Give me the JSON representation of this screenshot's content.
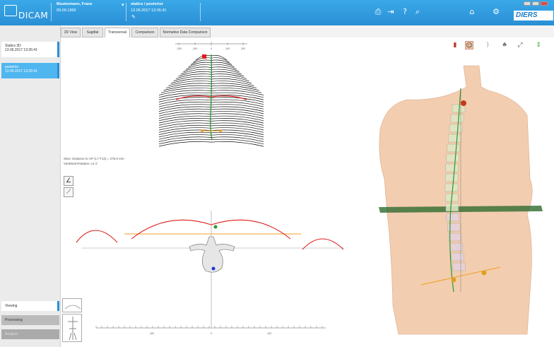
{
  "header": {
    "logo_text": "DICAM",
    "patient_name": "Mustermann, Franz",
    "patient_dob": "09.09.1966",
    "study_title": "statics / posterior",
    "study_date": "13.06.2017 13:26:41",
    "brand": "DIERS"
  },
  "studies": [
    {
      "label": "Statics 3D",
      "date": "13.06.2017 13:26:41"
    },
    {
      "label": "posterior",
      "date": "13.06.2017 13:26:41"
    }
  ],
  "nav": {
    "viewing": "Viewing",
    "processing": "Processing",
    "analysis": "Analysis"
  },
  "tabs": [
    "3D View",
    "Sagittal",
    "Transversal",
    "Comparison",
    "Normative Data Comparison"
  ],
  "active_tab": "Transversal",
  "info": {
    "slice_line": "Slice: Distance to VP (L7-T12) = 276.0 mm",
    "rotation_line": "Vertebral Rotation: L3 1°"
  },
  "scale": {
    "top_ticks": [
      "-200",
      "-100",
      "0",
      "100",
      "200"
    ],
    "bottom_ticks": [
      "-100",
      "0",
      "100"
    ]
  },
  "colors": {
    "header_blue": "#2a8fd6",
    "contour_red": "#e01c1c",
    "axis_orange": "#f0a020",
    "spine_green": "#2a9a2a",
    "skin": "#f3cdb0"
  },
  "icons": {
    "print": "printer-icon",
    "export": "export-icon",
    "help": "help-icon",
    "search": "search-icon",
    "home": "home-icon",
    "settings": "gear-icon"
  }
}
